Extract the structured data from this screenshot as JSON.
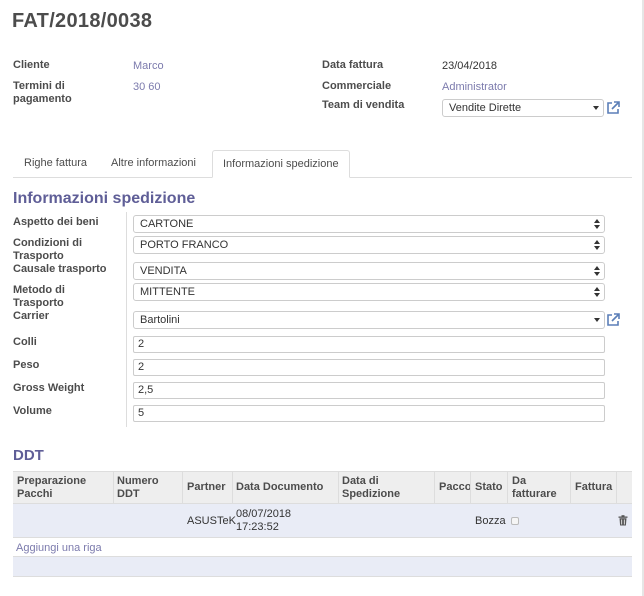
{
  "header": {
    "title": "FAT/2018/0038"
  },
  "info": {
    "cliente_label": "Cliente",
    "cliente_value": "Marco",
    "termini_label_1": "Termini di",
    "termini_label_2": "pagamento",
    "termini_value": "30 60",
    "data_fattura_label": "Data fattura",
    "data_fattura_value": "23/04/2018",
    "commerciale_label": "Commerciale",
    "commerciale_value": "Administrator",
    "team_label": "Team di vendita",
    "team_value": "Vendite Dirette"
  },
  "tabs": [
    {
      "label": "Righe fattura"
    },
    {
      "label": "Altre informazioni"
    },
    {
      "label": "Informazioni spedizione"
    }
  ],
  "shipping": {
    "section_title": "Informazioni spedizione",
    "aspetto_label": "Aspetto dei beni",
    "aspetto_value": "CARTONE",
    "condizioni_label_1": "Condizioni di",
    "condizioni_label_2": "Trasporto",
    "condizioni_value": "PORTO FRANCO",
    "causale_label": "Causale trasporto",
    "causale_value": "VENDITA",
    "metodo_label_1": "Metodo di",
    "metodo_label_2": "Trasporto",
    "metodo_value": "MITTENTE",
    "carrier_label": "Carrier",
    "carrier_value": "Bartolini",
    "colli_label": "Colli",
    "colli_value": "2",
    "peso_label": "Peso",
    "peso_value": "2",
    "gross_label": "Gross Weight",
    "gross_value": "2,5",
    "volume_label": "Volume",
    "volume_value": "5"
  },
  "ddt": {
    "title": "DDT",
    "columns": {
      "preparazione_1": "Preparazione",
      "preparazione_2": "Pacchi",
      "numero_1": "Numero",
      "numero_2": "DDT",
      "partner": "Partner",
      "data_documento": "Data Documento",
      "data_spedizione_1": "Data di",
      "data_spedizione_2": "Spedizione",
      "pacco": "Pacco",
      "stato": "Stato",
      "da_fatturare_1": "Da",
      "da_fatturare_2": "fatturare",
      "fattura": "Fattura"
    },
    "row": {
      "partner": "ASUSTeK",
      "data_documento_1": "08/07/2018",
      "data_documento_2": "17:23:52",
      "stato": "Bozza",
      "da_fatturare": false
    },
    "add_row": "Aggiungi una riga"
  },
  "colors": {
    "accent": "#7c7bad",
    "section": "#5f5e97",
    "row_highlight": "#e9ecf6"
  }
}
